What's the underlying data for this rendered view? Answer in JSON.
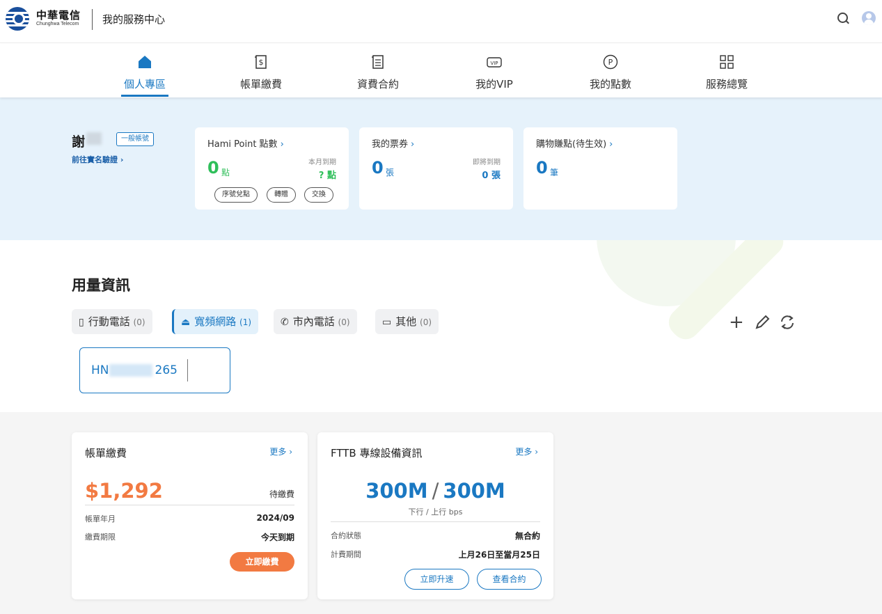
{
  "header": {
    "brand_cn": "中華電信",
    "brand_en": "Chunghwa Telecom",
    "title": "我的服務中心",
    "search_icon": "search-icon",
    "avatar_icon": "user-avatar-icon"
  },
  "nav": {
    "tabs": [
      {
        "label": "個人專區",
        "icon": "home-icon",
        "active": true
      },
      {
        "label": "帳單繳費",
        "icon": "bill-icon"
      },
      {
        "label": "資費合約",
        "icon": "contract-icon"
      },
      {
        "label": "我的VIP",
        "icon": "vip-icon"
      },
      {
        "label": "我的點數",
        "icon": "points-icon"
      },
      {
        "label": "服務總覽",
        "icon": "grid-icon"
      }
    ]
  },
  "profile": {
    "name": "謝",
    "account_type": "一般帳號",
    "verify_link": "前往實名驗證 ›"
  },
  "point_cards": [
    {
      "title": "Hami Point 點數",
      "value": "0",
      "unit": "點",
      "expire_label": "本月到期",
      "expire_value": "? 點",
      "buttons": [
        "序號兌點",
        "轉贈",
        "交換"
      ]
    },
    {
      "title": "我的票券",
      "value": "0",
      "unit": "張",
      "expire_label": "即將到期",
      "expire_value": "0 張"
    },
    {
      "title": "購物賺點(待生效)",
      "value": "0",
      "unit": "筆"
    }
  ],
  "usage": {
    "title": "用量資訊",
    "tabs": [
      {
        "label": "行動電話",
        "count": "(0)",
        "icon": "mobile-icon"
      },
      {
        "label": "寬頻網路",
        "count": "(1)",
        "icon": "router-icon",
        "active": true
      },
      {
        "label": "市內電話",
        "count": "(0)",
        "icon": "phone-icon"
      },
      {
        "label": "其他",
        "count": "(0)",
        "icon": "devices-icon"
      }
    ],
    "actions": {
      "add": "+",
      "edit_icon": "edit-icon",
      "sync_icon": "sync-icon"
    },
    "account": {
      "prefix": "HN",
      "suffix": "265"
    }
  },
  "bill_card": {
    "title": "帳單繳費",
    "more": "更多 ›",
    "amount": "$1,292",
    "status": "待繳費",
    "rows": [
      {
        "label": "帳單年月",
        "value": "2024/09"
      },
      {
        "label": "繳費期限",
        "value": "今天到期"
      }
    ],
    "pay_button": "立即繳費"
  },
  "fttb_card": {
    "title": "FTTB 專線設備資訊",
    "more": "更多 ›",
    "down": "300M",
    "separator": "/",
    "up": "300M",
    "speed_sub": "下行 / 上行 bps",
    "rows": [
      {
        "label": "合約狀態",
        "value": "無合約"
      },
      {
        "label": "計費期間",
        "value": "上月26日至當月25日"
      }
    ],
    "upgrade_button": "立即升速",
    "contract_button": "查看合約"
  },
  "colors": {
    "accent": "#1a78c2",
    "brand": "#1a4f9c",
    "points_green": "#2fbf5a",
    "amount_orange": "#f27a42",
    "hero_bg": "#e6f2fb"
  }
}
